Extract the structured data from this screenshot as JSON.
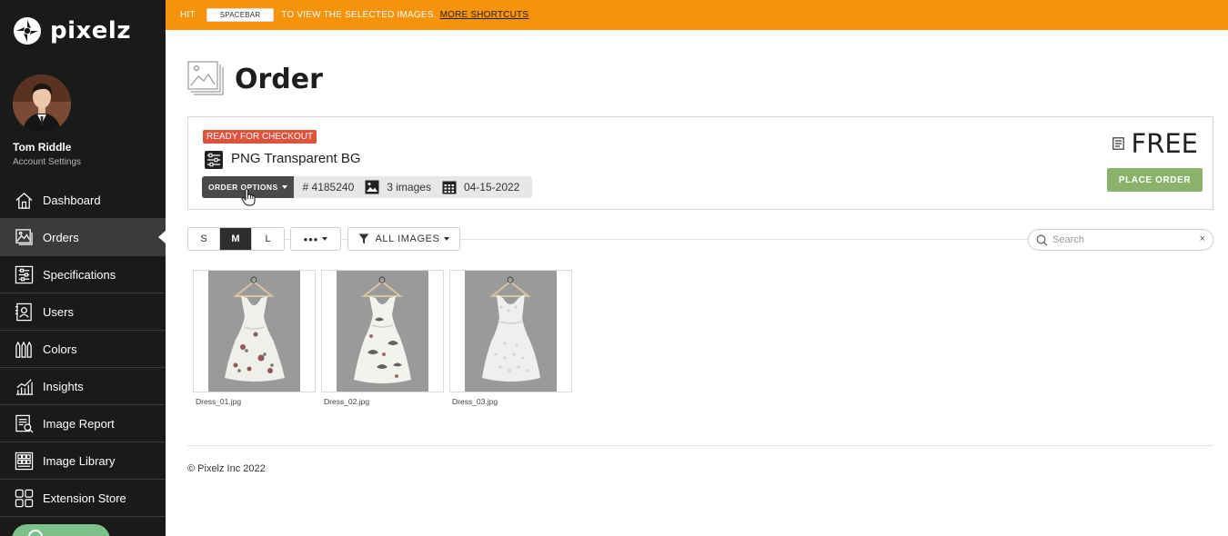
{
  "sidebar": {
    "brand": "pixelz",
    "user": {
      "name": "Tom Riddle",
      "settings_link": "Account Settings"
    },
    "items": [
      {
        "label": "Dashboard",
        "icon": "home-icon"
      },
      {
        "label": "Orders",
        "icon": "orders-icon",
        "active": true
      },
      {
        "label": "Specifications",
        "icon": "sliders-icon"
      },
      {
        "label": "Users",
        "icon": "users-icon"
      },
      {
        "label": "Colors",
        "icon": "colors-icon"
      },
      {
        "label": "Insights",
        "icon": "chart-icon"
      },
      {
        "label": "Image Report",
        "icon": "report-icon"
      },
      {
        "label": "Image Library",
        "icon": "library-icon"
      },
      {
        "label": "Extension Store",
        "icon": "store-icon"
      }
    ]
  },
  "banner": {
    "prefix": "HIT",
    "key": "SPACEBAR",
    "message": "TO VIEW THE SELECTED IMAGES.",
    "link": "MORE SHORTCUTS",
    "color": "#f7930a"
  },
  "page": {
    "title": "Order"
  },
  "order": {
    "status": "READY FOR CHECKOUT",
    "status_color": "#e0523c",
    "specification": "PNG Transparent BG",
    "options_label": "ORDER OPTIONS",
    "number": "# 4185240",
    "image_count": "3 images",
    "date": "04-15-2022",
    "price": "FREE",
    "place_order_label": "PLACE ORDER",
    "place_order_color": "#8bb26b"
  },
  "toolbar": {
    "sizes": [
      "S",
      "M",
      "L"
    ],
    "active_size": "M",
    "more_label": "•••",
    "filter_label": "ALL IMAGES",
    "search_placeholder": "Search",
    "clear_label": "×"
  },
  "images": [
    {
      "filename": "Dress_01.jpg"
    },
    {
      "filename": "Dress_02.jpg"
    },
    {
      "filename": "Dress_03.jpg"
    }
  ],
  "footer": {
    "copyright": "© Pixelz Inc 2022"
  }
}
